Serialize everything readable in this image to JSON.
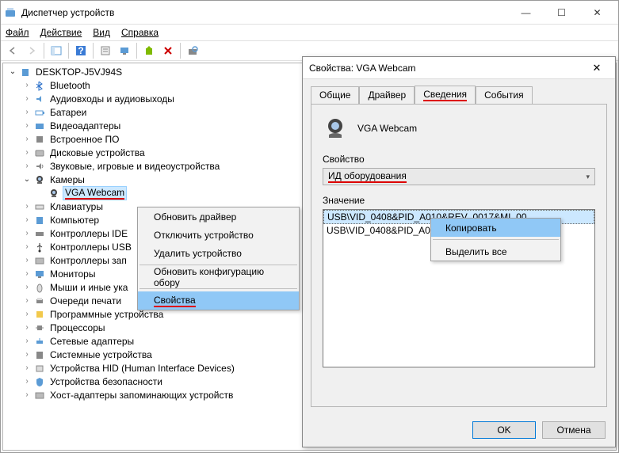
{
  "window": {
    "title": "Диспетчер устройств",
    "minimize_glyph": "—",
    "maximize_glyph": "☐",
    "close_glyph": "✕"
  },
  "menu": {
    "file": "Файл",
    "action": "Действие",
    "view": "Вид",
    "help": "Справка"
  },
  "toolbar_icons": [
    "back",
    "fwd",
    "pane",
    "help",
    "layers",
    "monitor",
    "pc",
    "tree2",
    "x",
    "rescan"
  ],
  "tree": {
    "root": "DESKTOP-J5VJ94S",
    "items": [
      {
        "icon": "bt",
        "label": "Bluetooth"
      },
      {
        "icon": "audio",
        "label": "Аудиовходы и аудиовыходы"
      },
      {
        "icon": "battery",
        "label": "Батареи"
      },
      {
        "icon": "video",
        "label": "Видеоадаптеры"
      },
      {
        "icon": "firmware",
        "label": "Встроенное ПО"
      },
      {
        "icon": "disk",
        "label": "Дисковые устройства"
      },
      {
        "icon": "sound",
        "label": "Звуковые, игровые и видеоустройства"
      },
      {
        "icon": "camera",
        "label": "Камеры",
        "open": true,
        "children": [
          {
            "icon": "webcam",
            "label": "VGA Webcam",
            "selected": true
          }
        ]
      },
      {
        "icon": "keyboard",
        "label": "Клавиатуры"
      },
      {
        "icon": "pc",
        "label": "Компьютер"
      },
      {
        "icon": "ide",
        "label": "Контроллеры IDE"
      },
      {
        "icon": "usb",
        "label": "Контроллеры USB"
      },
      {
        "icon": "storage",
        "label": "Контроллеры зап"
      },
      {
        "icon": "monitor",
        "label": "Мониторы"
      },
      {
        "icon": "mouse",
        "label": "Мыши и иные ука"
      },
      {
        "icon": "printer",
        "label": "Очереди печати"
      },
      {
        "icon": "soft",
        "label": "Программные устройства"
      },
      {
        "icon": "cpu",
        "label": "Процессоры"
      },
      {
        "icon": "net",
        "label": "Сетевые адаптеры"
      },
      {
        "icon": "sys",
        "label": "Системные устройства"
      },
      {
        "icon": "hid",
        "label": "Устройства HID (Human Interface Devices)"
      },
      {
        "icon": "sec",
        "label": "Устройства безопасности"
      },
      {
        "icon": "storhost",
        "label": "Хост-адаптеры запоминающих устройств"
      }
    ]
  },
  "context_menu": {
    "items": [
      "Обновить драйвер",
      "Отключить устройство",
      "Удалить устройство",
      "-",
      "Обновить конфигурацию обору",
      "-",
      "Свойства"
    ],
    "highlight_index": 6
  },
  "properties": {
    "title": "Свойства: VGA Webcam",
    "close_glyph": "✕",
    "tabs": [
      "Общие",
      "Драйвер",
      "Сведения",
      "События"
    ],
    "active_tab": 2,
    "device_name": "VGA Webcam",
    "prop_label": "Свойство",
    "prop_combo": "ИД оборудования",
    "value_label": "Значение",
    "values": [
      "USB\\VID_0408&PID_A010&REV_0017&MI_00",
      "USB\\VID_0408&PID_A010"
    ],
    "ok": "OK",
    "cancel": "Отмена"
  },
  "context_menu2": {
    "items": [
      "Копировать",
      "-",
      "Выделить все"
    ],
    "highlight_index": 0
  }
}
